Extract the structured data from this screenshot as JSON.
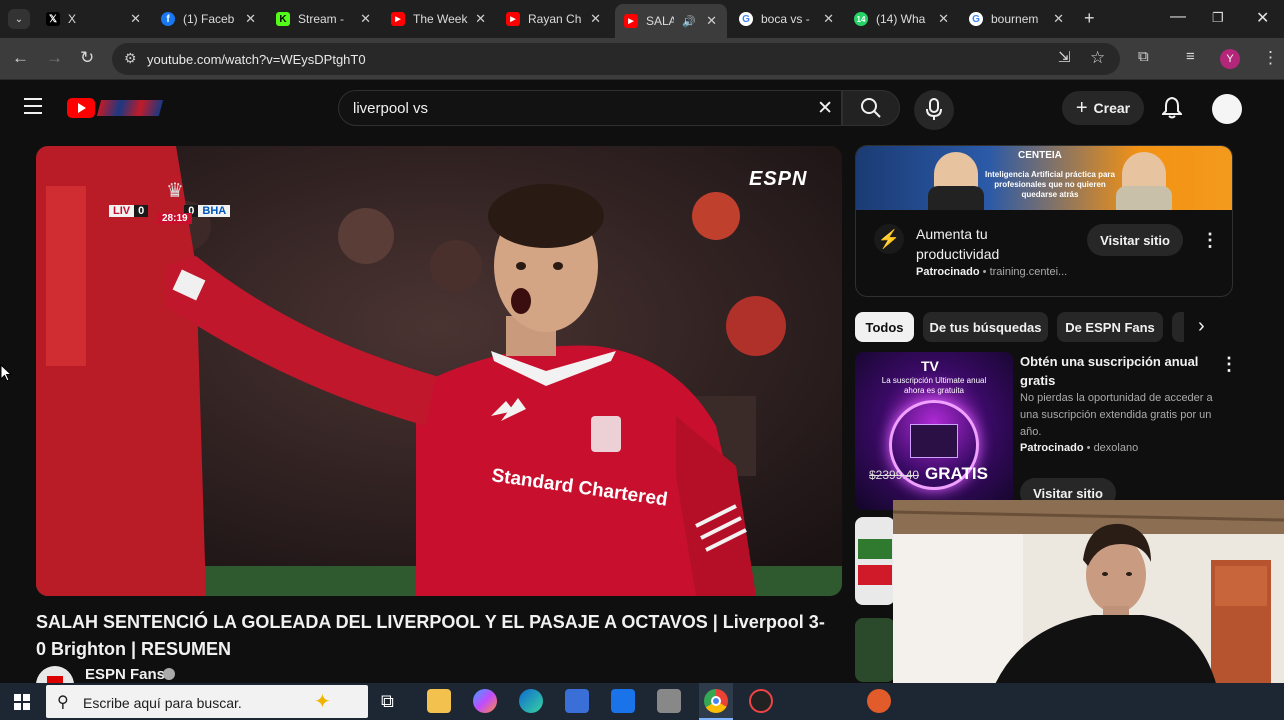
{
  "browser": {
    "tabs": [
      {
        "title": "X",
        "favicon": "x-logo-icon",
        "color": "#000000"
      },
      {
        "title": "(1) Faceb",
        "favicon": "facebook-icon",
        "color": "#1877f2"
      },
      {
        "title": "Stream -",
        "favicon": "kick-icon",
        "color": "#53fc18"
      },
      {
        "title": "The Week",
        "favicon": "youtube-icon",
        "color": "#ff0000"
      },
      {
        "title": "Rayan Ch",
        "favicon": "youtube-icon",
        "color": "#ff0000"
      },
      {
        "title": "SALA",
        "favicon": "youtube-icon",
        "color": "#ff0000"
      },
      {
        "title": "boca vs -",
        "favicon": "google-icon",
        "color": "#4285f4"
      },
      {
        "title": "(14) Wha",
        "favicon": "whatsapp-icon",
        "color": "#25d366"
      },
      {
        "title": "bournem",
        "favicon": "google-icon",
        "color": "#4285f4"
      }
    ],
    "url": "youtube.com/watch?v=WEysDPtghT0"
  },
  "youtube": {
    "search_query": "liverpool vs",
    "create_label": "Crear",
    "video": {
      "title": "SALAH SENTENCIÓ LA GOLEADA DEL LIVERPOOL Y EL PASAJE A OCTAVOS | Liverpool 3-0 Brighton | RESUMEN",
      "channel": "ESPN Fans",
      "broadcaster_logo": "ESPN",
      "scoreboard": {
        "home": "LIV",
        "home_score": "0",
        "away": "BHA",
        "away_score": "0",
        "clock": "28:19"
      },
      "shirt_text": "Standard Chartered"
    },
    "ad": {
      "brand": "CENTEIA",
      "banner_text": "Inteligencia Artificial práctica para profesionales que no quieren quedarse atrás",
      "title": "Aumenta tu productividad",
      "sponsored_label": "Patrocinado",
      "domain": "training.centei...",
      "visit_label": "Visitar sitio"
    },
    "chips": [
      "Todos",
      "De tus búsquedas",
      "De ESPN Fans"
    ],
    "promo": {
      "title": "Obtén una suscripción anual gratis",
      "description": "No pierdas la oportunidad de acceder a una suscripción extendida gratis por un año.",
      "sponsored_label": "Patrocinado",
      "advertiser": "dexolano",
      "visit_label": "Visitar sitio",
      "thumb_price": "$2399.40",
      "thumb_badge": "GRATIS",
      "thumb_header": "La suscripción Ultimate anual ahora es gratuita"
    }
  },
  "taskbar": {
    "search_placeholder": "Escribe aquí para buscar."
  },
  "colors": {
    "youtube_red": "#ff0000",
    "background": "#0f0f0f",
    "jersey_red": "#c8102e"
  }
}
